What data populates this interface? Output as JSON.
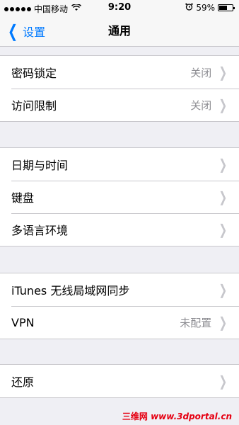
{
  "status_bar": {
    "carrier": "中国移动",
    "time": "9:20",
    "battery_percent": "59%",
    "battery_level": 0.59
  },
  "nav": {
    "back_label": "设置",
    "title": "通用"
  },
  "groups": [
    [
      {
        "label": "密码锁定",
        "value": "关闭"
      },
      {
        "label": "访问限制",
        "value": "关闭"
      }
    ],
    [
      {
        "label": "日期与时间",
        "value": ""
      },
      {
        "label": "键盘",
        "value": ""
      },
      {
        "label": "多语言环境",
        "value": ""
      }
    ],
    [
      {
        "label": "iTunes 无线局域网同步",
        "value": ""
      },
      {
        "label": "VPN",
        "value": "未配置"
      }
    ],
    [
      {
        "label": "还原",
        "value": ""
      }
    ]
  ],
  "watermark": {
    "cn": "三维网",
    "url": "www.3dportal.cn"
  }
}
